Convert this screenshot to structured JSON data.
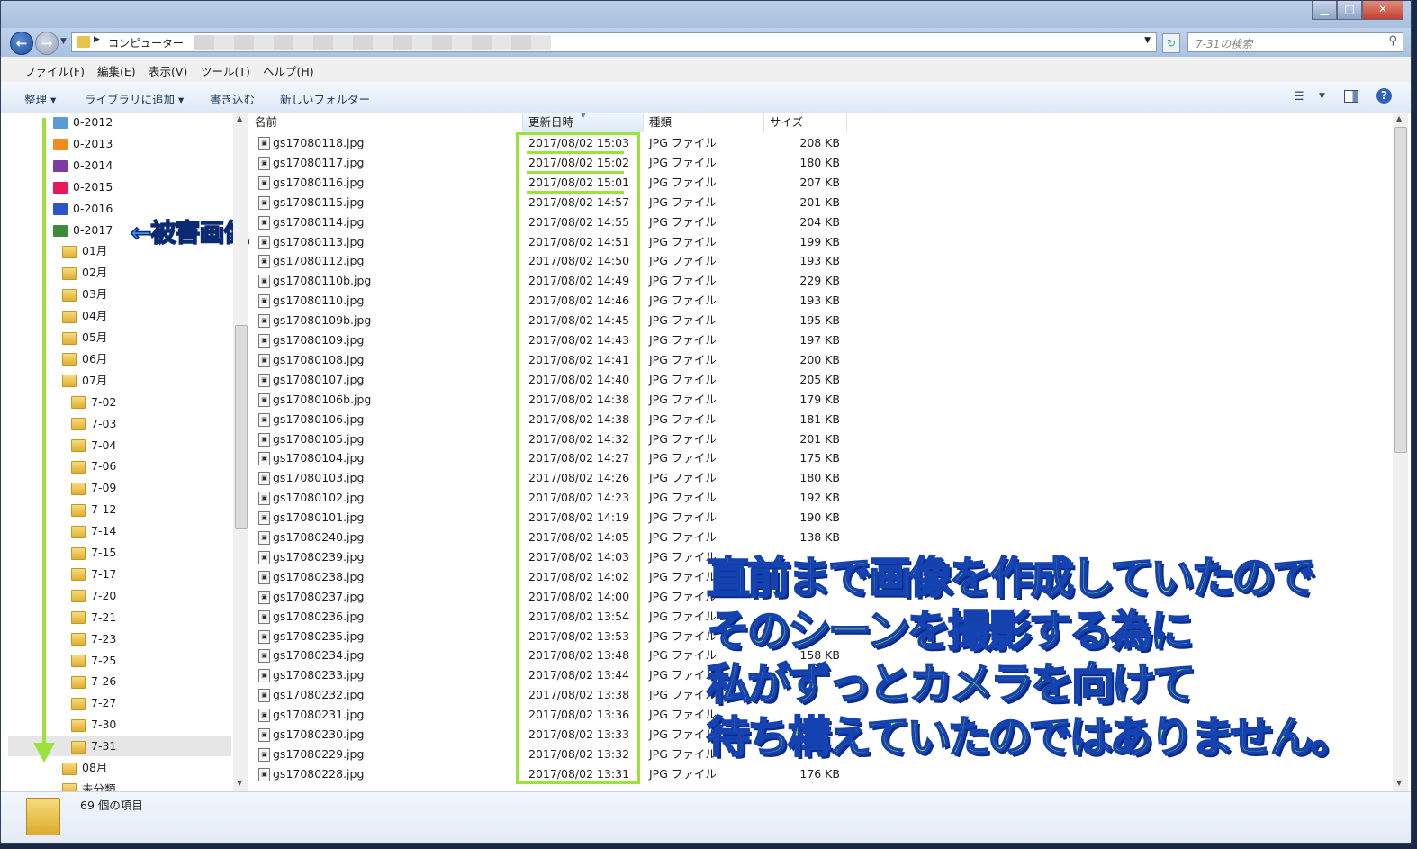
{
  "window": {
    "minimize": "▁",
    "maximize": "□",
    "close": "✕"
  },
  "address": {
    "path": "コンピューター",
    "search_placeholder": "7-31の検索"
  },
  "menu": [
    "ファイル(F)",
    "編集(E)",
    "表示(V)",
    "ツール(T)",
    "ヘルプ(H)"
  ],
  "toolbar": {
    "organize": "整理 ▾",
    "add_to_library": "ライブラリに追加 ▾",
    "burn": "書き込む",
    "new_folder": "新しいフォルダー"
  },
  "tree": [
    {
      "label": "0-2012",
      "kind": "img",
      "color": "#5b9bd5"
    },
    {
      "label": "0-2013",
      "kind": "img",
      "color": "#f28c1e"
    },
    {
      "label": "0-2014",
      "kind": "img",
      "color": "#7d3ca0"
    },
    {
      "label": "0-2015",
      "kind": "img",
      "color": "#e8195a"
    },
    {
      "label": "0-2016",
      "kind": "img",
      "color": "#2a54c8"
    },
    {
      "label": "0-2017",
      "kind": "img",
      "color": "#3e8a3a"
    },
    {
      "label": "01月",
      "kind": "folder"
    },
    {
      "label": "02月",
      "kind": "folder"
    },
    {
      "label": "03月",
      "kind": "folder"
    },
    {
      "label": "04月",
      "kind": "folder"
    },
    {
      "label": "05月",
      "kind": "folder"
    },
    {
      "label": "06月",
      "kind": "folder"
    },
    {
      "label": "07月",
      "kind": "folder"
    },
    {
      "label": "7-02",
      "kind": "folder"
    },
    {
      "label": "7-03",
      "kind": "folder"
    },
    {
      "label": "7-04",
      "kind": "folder"
    },
    {
      "label": "7-06",
      "kind": "folder"
    },
    {
      "label": "7-09",
      "kind": "folder"
    },
    {
      "label": "7-12",
      "kind": "folder"
    },
    {
      "label": "7-14",
      "kind": "folder"
    },
    {
      "label": "7-15",
      "kind": "folder"
    },
    {
      "label": "7-17",
      "kind": "folder"
    },
    {
      "label": "7-20",
      "kind": "folder"
    },
    {
      "label": "7-21",
      "kind": "folder"
    },
    {
      "label": "7-23",
      "kind": "folder"
    },
    {
      "label": "7-25",
      "kind": "folder"
    },
    {
      "label": "7-26",
      "kind": "folder"
    },
    {
      "label": "7-27",
      "kind": "folder"
    },
    {
      "label": "7-30",
      "kind": "folder"
    },
    {
      "label": "7-31",
      "kind": "folder",
      "selected": true
    },
    {
      "label": "08月",
      "kind": "folder"
    },
    {
      "label": "未分類",
      "kind": "folder"
    }
  ],
  "tree_annotation": "←被害画像用フォルダ",
  "columns": {
    "name": "名前",
    "date": "更新日時",
    "type": "種類",
    "size": "サイズ"
  },
  "files": [
    {
      "name": "gs17080118.jpg",
      "date": "2017/08/02 15:03",
      "type": "JPG ファイル",
      "size": "208 KB"
    },
    {
      "name": "gs17080117.jpg",
      "date": "2017/08/02 15:02",
      "type": "JPG ファイル",
      "size": "180 KB"
    },
    {
      "name": "gs17080116.jpg",
      "date": "2017/08/02 15:01",
      "type": "JPG ファイル",
      "size": "207 KB"
    },
    {
      "name": "gs17080115.jpg",
      "date": "2017/08/02 14:57",
      "type": "JPG ファイル",
      "size": "201 KB"
    },
    {
      "name": "gs17080114.jpg",
      "date": "2017/08/02 14:55",
      "type": "JPG ファイル",
      "size": "204 KB"
    },
    {
      "name": "gs17080113.jpg",
      "date": "2017/08/02 14:51",
      "type": "JPG ファイル",
      "size": "199 KB"
    },
    {
      "name": "gs17080112.jpg",
      "date": "2017/08/02 14:50",
      "type": "JPG ファイル",
      "size": "193 KB"
    },
    {
      "name": "gs17080110b.jpg",
      "date": "2017/08/02 14:49",
      "type": "JPG ファイル",
      "size": "229 KB"
    },
    {
      "name": "gs17080110.jpg",
      "date": "2017/08/02 14:46",
      "type": "JPG ファイル",
      "size": "193 KB"
    },
    {
      "name": "gs17080109b.jpg",
      "date": "2017/08/02 14:45",
      "type": "JPG ファイル",
      "size": "195 KB"
    },
    {
      "name": "gs17080109.jpg",
      "date": "2017/08/02 14:43",
      "type": "JPG ファイル",
      "size": "197 KB"
    },
    {
      "name": "gs17080108.jpg",
      "date": "2017/08/02 14:41",
      "type": "JPG ファイル",
      "size": "200 KB"
    },
    {
      "name": "gs17080107.jpg",
      "date": "2017/08/02 14:40",
      "type": "JPG ファイル",
      "size": "205 KB"
    },
    {
      "name": "gs17080106b.jpg",
      "date": "2017/08/02 14:38",
      "type": "JPG ファイル",
      "size": "179 KB"
    },
    {
      "name": "gs17080106.jpg",
      "date": "2017/08/02 14:38",
      "type": "JPG ファイル",
      "size": "181 KB"
    },
    {
      "name": "gs17080105.jpg",
      "date": "2017/08/02 14:32",
      "type": "JPG ファイル",
      "size": "201 KB"
    },
    {
      "name": "gs17080104.jpg",
      "date": "2017/08/02 14:27",
      "type": "JPG ファイル",
      "size": "175 KB"
    },
    {
      "name": "gs17080103.jpg",
      "date": "2017/08/02 14:26",
      "type": "JPG ファイル",
      "size": "180 KB"
    },
    {
      "name": "gs17080102.jpg",
      "date": "2017/08/02 14:23",
      "type": "JPG ファイル",
      "size": "192 KB"
    },
    {
      "name": "gs17080101.jpg",
      "date": "2017/08/02 14:19",
      "type": "JPG ファイル",
      "size": "190 KB"
    },
    {
      "name": "gs17080240.jpg",
      "date": "2017/08/02 14:05",
      "type": "JPG ファイル",
      "size": "138 KB"
    },
    {
      "name": "gs17080239.jpg",
      "date": "2017/08/02 14:03",
      "type": "JPG ファイル",
      "size": ""
    },
    {
      "name": "gs17080238.jpg",
      "date": "2017/08/02 14:02",
      "type": "JPG ファイル",
      "size": ""
    },
    {
      "name": "gs17080237.jpg",
      "date": "2017/08/02 14:00",
      "type": "JPG ファイル",
      "size": ""
    },
    {
      "name": "gs17080236.jpg",
      "date": "2017/08/02 13:54",
      "type": "JPG ファイル",
      "size": ""
    },
    {
      "name": "gs17080235.jpg",
      "date": "2017/08/02 13:53",
      "type": "JPG ファイル",
      "size": ""
    },
    {
      "name": "gs17080234.jpg",
      "date": "2017/08/02 13:48",
      "type": "JPG ファイル",
      "size": "158 KB"
    },
    {
      "name": "gs17080233.jpg",
      "date": "2017/08/02 13:44",
      "type": "JPG ファイル",
      "size": ""
    },
    {
      "name": "gs17080232.jpg",
      "date": "2017/08/02 13:38",
      "type": "JPG ファイル",
      "size": ""
    },
    {
      "name": "gs17080231.jpg",
      "date": "2017/08/02 13:36",
      "type": "JPG ファイル",
      "size": ""
    },
    {
      "name": "gs17080230.jpg",
      "date": "2017/08/02 13:33",
      "type": "JPG ファイル",
      "size": ""
    },
    {
      "name": "gs17080229.jpg",
      "date": "2017/08/02 13:32",
      "type": "JPG ファイル",
      "size": ""
    },
    {
      "name": "gs17080228.jpg",
      "date": "2017/08/02 13:31",
      "type": "JPG ファイル",
      "size": "176 KB"
    }
  ],
  "overlay_lines": [
    "直前まで画像を作成していたので",
    "そのシーンを撮影する為に",
    "私がずっとカメラを向けて",
    "待ち構えていたのではありません。"
  ],
  "status": {
    "item_count": "69 個の項目"
  },
  "colors": {
    "highlight": "#9be33a",
    "annotation_text": "#3c96ff"
  }
}
